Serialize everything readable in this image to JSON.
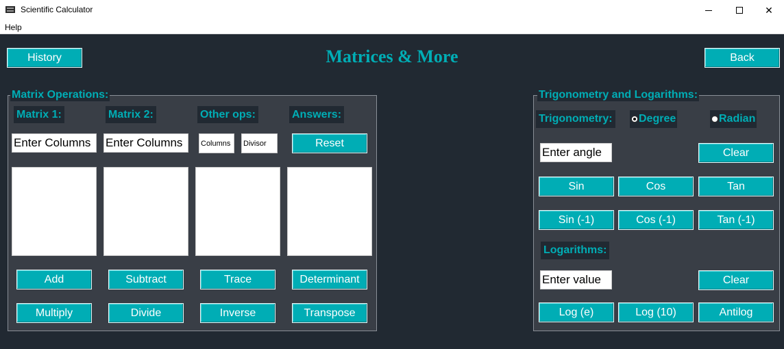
{
  "window": {
    "title": "Scientific Calculator",
    "icon": "calculator-app-icon",
    "controls": {
      "minimize": "minimize-icon",
      "maximize": "maximize-icon",
      "close": "✕"
    }
  },
  "menu": {
    "help": "Help"
  },
  "header": {
    "title": "Matrices & More",
    "history_label": "History",
    "back_label": "Back"
  },
  "matrix": {
    "frame_title": "Matrix Operations:",
    "headers": [
      "Matrix 1:",
      "Matrix 2:",
      "Other ops:",
      "Answers:"
    ],
    "matrix1_placeholder": "Enter Columns",
    "matrix2_placeholder": "Enter Columns",
    "columns_placeholder": "Columns",
    "divisor_placeholder": "Divisor",
    "reset_label": "Reset",
    "buttons": {
      "add": "Add",
      "subtract": "Subtract",
      "trace": "Trace",
      "determinant": "Determinant",
      "multiply": "Multiply",
      "divide": "Divide",
      "inverse": "Inverse",
      "transpose": "Transpose"
    }
  },
  "trig": {
    "frame_title": "Trigonometry and Logarithms:",
    "trig_label": "Trigonometry:",
    "degree_label": "Degree",
    "radian_label": "Radian",
    "selected_unit": "Degree",
    "angle_placeholder": "Enter angle",
    "clear_label": "Clear",
    "buttons": {
      "sin": "Sin",
      "cos": "Cos",
      "tan": "Tan",
      "asin": "Sin (-1)",
      "acos": "Cos (-1)",
      "atan": "Tan (-1)"
    },
    "log_label": "Logarithms:",
    "value_placeholder": "Enter value",
    "log_clear_label": "Clear",
    "log_buttons": {
      "ln": "Log (e)",
      "log10": "Log (10)",
      "antilog": "Antilog"
    }
  },
  "colors": {
    "accent": "#00adb5",
    "background": "#212932",
    "panel": "#393e46"
  }
}
